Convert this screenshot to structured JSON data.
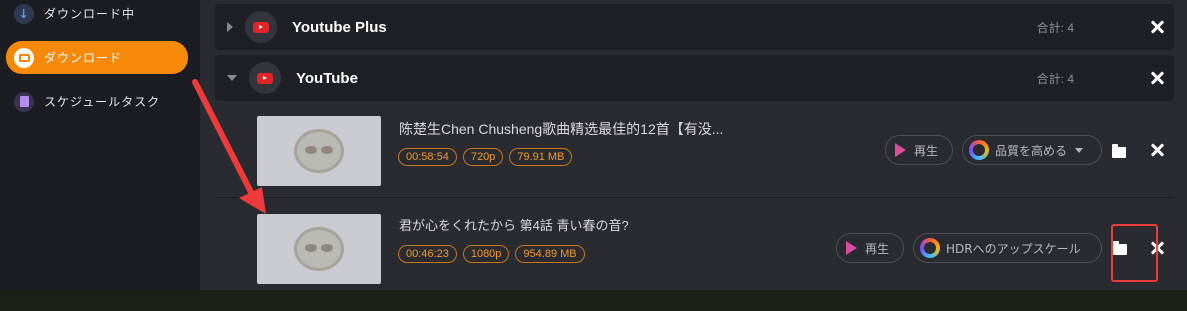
{
  "sidebar": {
    "items": [
      {
        "label": "ダウンロード中",
        "icon": "download-arrow-icon",
        "active": false
      },
      {
        "label": "ダウンロード",
        "icon": "folder-icon",
        "active": true
      },
      {
        "label": "スケジュールタスク",
        "icon": "schedule-list-icon",
        "active": false
      }
    ]
  },
  "groups": [
    {
      "title": "Youtube Plus",
      "total": "合計: 4",
      "expanded": false
    },
    {
      "title": "YouTube",
      "total": "合計: 4",
      "expanded": true
    }
  ],
  "items": [
    {
      "title": "陈楚生Chen Chusheng歌曲精选最佳的12首【有没...",
      "duration": "00:58:54",
      "quality": "720p",
      "size": "79.91 MB",
      "play_label": "再生",
      "enhance_label": "品質を高める"
    },
    {
      "title": "君が心をくれたから 第4話 青い春の音?",
      "duration": "00:46:23",
      "quality": "1080p",
      "size": "954.89 MB",
      "play_label": "再生",
      "enhance_label": "HDRへのアップスケール"
    }
  ],
  "colors": {
    "accent": "#f58a0a",
    "annotation": "#ee3a3a"
  }
}
